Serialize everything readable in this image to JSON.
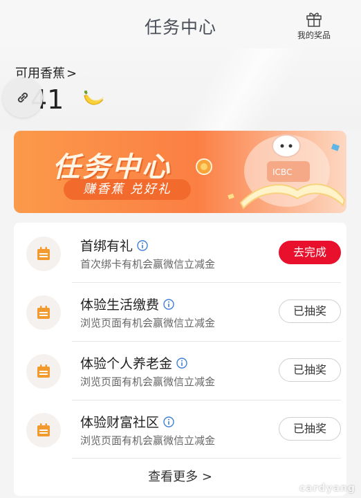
{
  "header": {
    "title": "任务中心",
    "prizes_label": "我的奖品"
  },
  "balance": {
    "label": "可用香蕉",
    "chevron": ">",
    "value": "41"
  },
  "banner": {
    "title": "任务中心",
    "subtitle": "赚香蕉 兑好礼"
  },
  "tasks": [
    {
      "title": "首绑有礼",
      "desc": "首次绑卡有机会赢微信立减金",
      "button": "去完成",
      "status": "primary"
    },
    {
      "title": "体验生活缴费",
      "desc": "浏览页面有机会赢微信立减金",
      "button": "已抽奖",
      "status": "done"
    },
    {
      "title": "体验个人养老金",
      "desc": "浏览页面有机会赢微信立减金",
      "button": "已抽奖",
      "status": "done"
    },
    {
      "title": "体验财富社区",
      "desc": "浏览页面有机会赢微信立减金",
      "button": "已抽奖",
      "status": "done"
    }
  ],
  "more": "查看更多 >",
  "watermark": "cardyang",
  "colors": {
    "accent_red": "#e8102c",
    "banner_orange": "#fb7f44",
    "icon_orange": "#f29a2e"
  },
  "icons": [
    "gift-icon",
    "banana-icon",
    "link-icon",
    "calendar-icon",
    "info-icon"
  ]
}
